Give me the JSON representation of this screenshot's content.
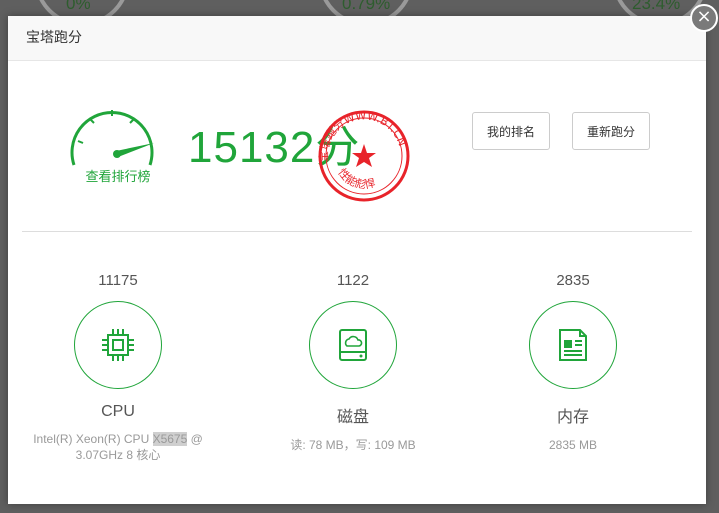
{
  "background": {
    "gauge_values": [
      "0%",
      "0.79%",
      "23.4%"
    ]
  },
  "dialog": {
    "title": "宝塔跑分",
    "close_symbol": "×"
  },
  "summary": {
    "rank_link": "查看排行榜",
    "score": "15132",
    "score_unit": "分",
    "stamp_top": "宝塔跑分WWW.BT.CN",
    "stamp_bottom": "性能彪悍",
    "my_rank_button": "我的排名",
    "rerun_button": "重新跑分"
  },
  "metrics": [
    {
      "score": "11175",
      "name": "CPU",
      "desc_a": "Intel(R) Xeon(R) CPU ",
      "desc_hl": "X5675",
      "desc_b": " @ 3.07GHz 8 核心",
      "icon": "cpu-chip-icon"
    },
    {
      "score": "1122",
      "name": "磁盘",
      "desc": "读: 78 MB，写: 109 MB",
      "icon": "disk-drive-icon"
    },
    {
      "score": "2835",
      "name": "内存",
      "desc": "2835 MB",
      "icon": "memory-doc-icon"
    }
  ],
  "colors": {
    "accent": "#20a53a",
    "stamp": "#e8232a"
  }
}
